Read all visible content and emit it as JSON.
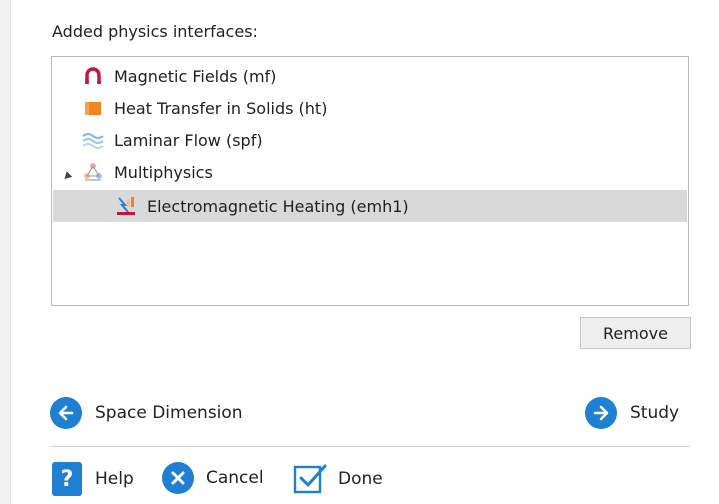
{
  "section_label": "Added physics interfaces:",
  "tree": {
    "items": [
      {
        "label": "Magnetic Fields (mf)",
        "icon": "magnet-icon"
      },
      {
        "label": "Heat Transfer in Solids (ht)",
        "icon": "heat-transfer-icon"
      },
      {
        "label": "Laminar Flow (spf)",
        "icon": "laminar-flow-icon"
      },
      {
        "label": "Multiphysics",
        "icon": "multiphysics-icon",
        "expanded": true
      },
      {
        "label": "Electromagnetic Heating (emh1)",
        "icon": "electromagnetic-heating-icon",
        "selected": true
      }
    ]
  },
  "buttons": {
    "remove": "Remove",
    "space_dimension": "Space Dimension",
    "study": "Study",
    "help": "Help",
    "cancel": "Cancel",
    "done": "Done"
  },
  "colors": {
    "accent": "#1e7fd3",
    "selection": "#d9d9d9",
    "magnet": "#c3173f",
    "heat": "#f58220"
  }
}
